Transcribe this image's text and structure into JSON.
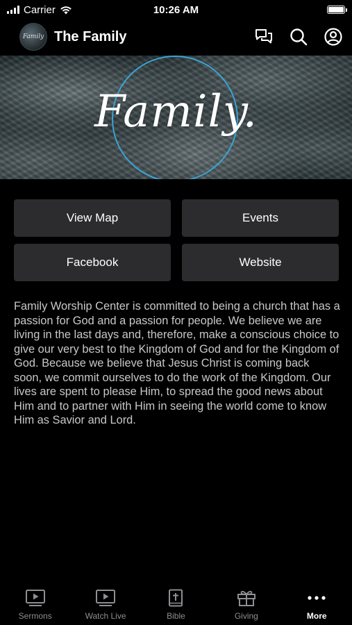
{
  "status_bar": {
    "carrier": "Carrier",
    "time": "10:26 AM"
  },
  "header": {
    "logo_text": "Family",
    "title": "The Family"
  },
  "banner": {
    "script_text": "Family.",
    "ring_color": "#3aa3d6"
  },
  "buttons": [
    {
      "label": "View Map"
    },
    {
      "label": "Events"
    },
    {
      "label": "Facebook"
    },
    {
      "label": "Website"
    }
  ],
  "description": "Family Worship Center is committed to being a church that has a passion for God and a passion for people. We believe we are living in the last days and, therefore, make a conscious choice to give our very best to the Kingdom of God and for the Kingdom of God. Because we believe that Jesus Christ is coming back soon, we commit ourselves to do the work of the Kingdom. Our lives are spent to please Him, to spread the good news about Him and to partner with Him in seeing the world come to know Him as Savior and Lord.",
  "tabs": [
    {
      "label": "Sermons",
      "icon": "sermons-icon",
      "active": false
    },
    {
      "label": "Watch Live",
      "icon": "watch-live-icon",
      "active": false
    },
    {
      "label": "Bible",
      "icon": "bible-icon",
      "active": false
    },
    {
      "label": "Giving",
      "icon": "gift-icon",
      "active": false
    },
    {
      "label": "More",
      "icon": "more-icon",
      "active": true
    }
  ],
  "colors": {
    "background": "#000000",
    "button_bg": "#2c2c2e",
    "tab_inactive": "#8e8e93",
    "tab_active": "#ffffff"
  }
}
